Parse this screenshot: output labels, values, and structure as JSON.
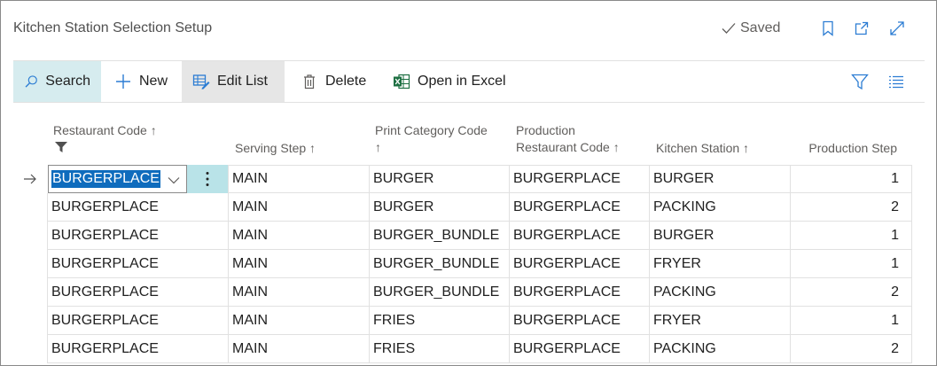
{
  "window": {
    "title": "Kitchen Station Selection Setup",
    "status": "Saved",
    "icons": [
      "checkmark-icon",
      "bookmark-icon",
      "open-new-window-icon",
      "expand-icon"
    ]
  },
  "toolbar": {
    "search_label": "Search",
    "new_label": "New",
    "edit_list_label": "Edit List",
    "delete_label": "Delete",
    "open_excel_label": "Open in Excel",
    "icons": [
      "search-icon",
      "plus-icon",
      "edit-list-icon",
      "trash-icon",
      "excel-icon",
      "filter-icon",
      "list-view-icon"
    ]
  },
  "grid": {
    "headers": {
      "restaurant_code": "Restaurant Code ↑",
      "serving_step": "Serving Step ↑",
      "print_category_line1": "Print Category Code",
      "print_category_line2": "↑",
      "production_restaurant_line1": "Production",
      "production_restaurant_line2": "Restaurant Code ↑",
      "kitchen_station": "Kitchen Station ↑",
      "production_step": "Production Step"
    },
    "rows": [
      {
        "restaurant": "BURGERPLACE",
        "serving_step": "MAIN",
        "print_category": "BURGER",
        "production_restaurant": "BURGERPLACE",
        "kitchen_station": "BURGER",
        "production_step": "1"
      },
      {
        "restaurant": "BURGERPLACE",
        "serving_step": "MAIN",
        "print_category": "BURGER",
        "production_restaurant": "BURGERPLACE",
        "kitchen_station": "PACKING",
        "production_step": "2"
      },
      {
        "restaurant": "BURGERPLACE",
        "serving_step": "MAIN",
        "print_category": "BURGER_BUNDLE",
        "production_restaurant": "BURGERPLACE",
        "kitchen_station": "BURGER",
        "production_step": "1"
      },
      {
        "restaurant": "BURGERPLACE",
        "serving_step": "MAIN",
        "print_category": "BURGER_BUNDLE",
        "production_restaurant": "BURGERPLACE",
        "kitchen_station": "FRYER",
        "production_step": "1"
      },
      {
        "restaurant": "BURGERPLACE",
        "serving_step": "MAIN",
        "print_category": "BURGER_BUNDLE",
        "production_restaurant": "BURGERPLACE",
        "kitchen_station": "PACKING",
        "production_step": "2"
      },
      {
        "restaurant": "BURGERPLACE",
        "serving_step": "MAIN",
        "print_category": "FRIES",
        "production_restaurant": "BURGERPLACE",
        "kitchen_station": "FRYER",
        "production_step": "1"
      },
      {
        "restaurant": "BURGERPLACE",
        "serving_step": "MAIN",
        "print_category": "FRIES",
        "production_restaurant": "BURGERPLACE",
        "kitchen_station": "PACKING",
        "production_step": "2"
      }
    ]
  },
  "colors": {
    "accent": "#0f6cbd",
    "icon_blue": "#2b7cd3",
    "excel_green": "#1d6f42",
    "search_bg": "#d6ecef",
    "dots_bg": "#b9e3e8"
  }
}
